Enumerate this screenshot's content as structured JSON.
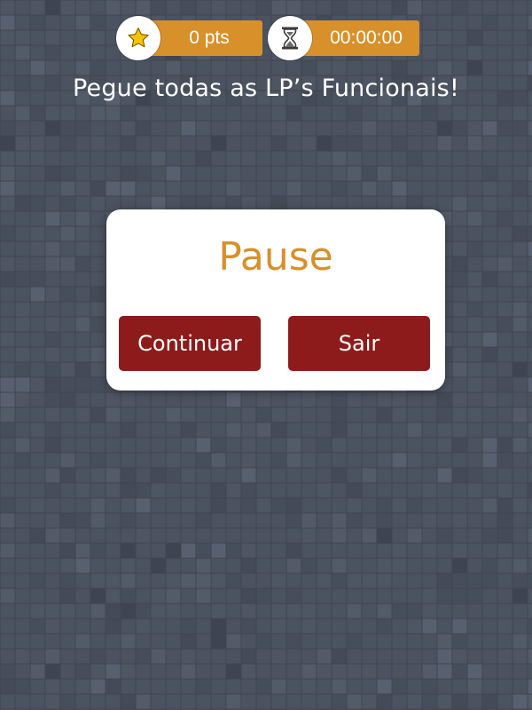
{
  "colors": {
    "background": "#4b5260",
    "accent_orange": "#d8902b",
    "button_red": "#8e1b1b",
    "dialog_bg": "#ffffff",
    "star_yellow": "#f7c300"
  },
  "hud": {
    "score_text": "0 pts",
    "score_icon": "star-icon",
    "timer_text": "00:00:00",
    "timer_icon": "hourglass-icon"
  },
  "instruction_text": "Pegue todas as LP’s Funcionais!",
  "pause_dialog": {
    "title": "Pause",
    "continue_label": "Continuar",
    "exit_label": "Sair"
  }
}
